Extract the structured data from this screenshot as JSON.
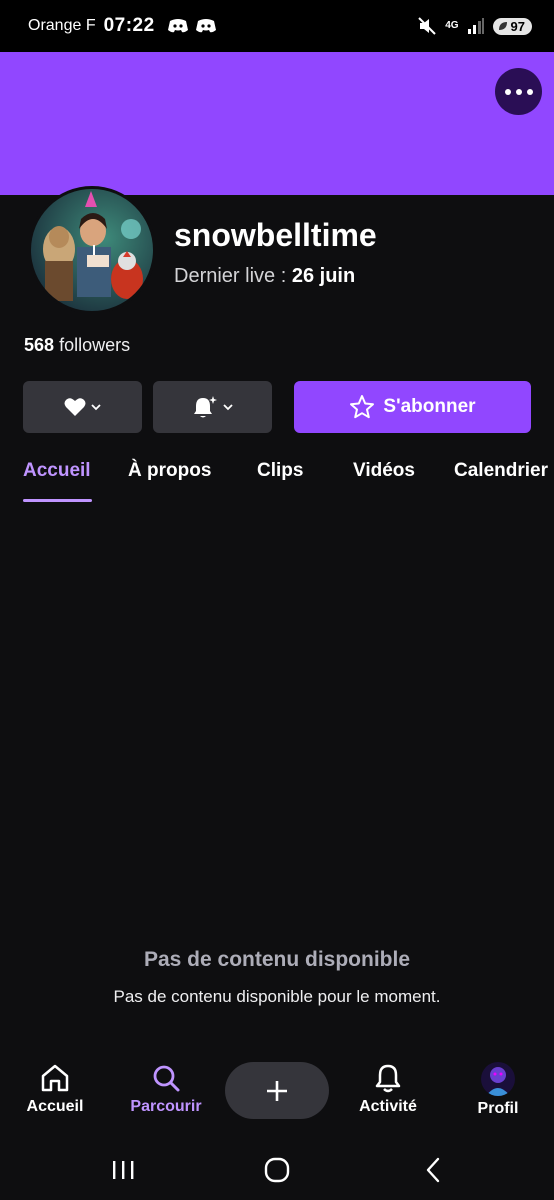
{
  "status_bar": {
    "carrier": "Orange F",
    "time": "07:22",
    "network": "4G",
    "battery": "97"
  },
  "channel": {
    "name": "snowbelltime",
    "last_live_label": "Dernier live :",
    "last_live_date": "26 juin",
    "followers_count": "568",
    "followers_label": "followers"
  },
  "actions": {
    "subscribe_label": "S'abonner"
  },
  "tabs": [
    {
      "label": "Accueil",
      "active": true
    },
    {
      "label": "À propos",
      "active": false
    },
    {
      "label": "Clips",
      "active": false
    },
    {
      "label": "Vidéos",
      "active": false
    },
    {
      "label": "Calendrier",
      "active": false
    }
  ],
  "empty_state": {
    "title": "Pas de contenu disponible",
    "subtitle": "Pas de contenu disponible pour le moment."
  },
  "bottom_nav": {
    "items": [
      {
        "label": "Accueil",
        "icon": "home-icon",
        "active": false
      },
      {
        "label": "Parcourir",
        "icon": "search-icon",
        "active": true
      },
      {
        "label": "Activité",
        "icon": "bell-icon",
        "active": false
      },
      {
        "label": "Profil",
        "icon": "profile-avatar",
        "active": false
      }
    ],
    "create_icon": "plus-icon"
  },
  "system_nav": {
    "icons": [
      "recent-apps-icon",
      "home-circle-icon",
      "back-icon"
    ]
  },
  "colors": {
    "background": "#0e0e10",
    "brand_purple": "#9147ff",
    "active_purple": "#bf94ff",
    "button_gray": "#35353b"
  }
}
